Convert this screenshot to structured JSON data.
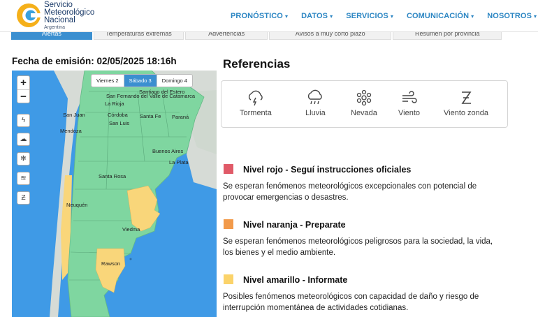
{
  "brand": {
    "line1": "Servicio",
    "line2": "Meteorológico",
    "line3": "Nacional",
    "line4": "Argentina"
  },
  "nav": [
    {
      "label": "PRONÓSTICO"
    },
    {
      "label": "DATOS"
    },
    {
      "label": "SERVICIOS"
    },
    {
      "label": "COMUNICACIÓN"
    },
    {
      "label": "NOSOTROS"
    }
  ],
  "tabs": [
    {
      "label": "Alertas"
    },
    {
      "label": "Temperaturas extremas"
    },
    {
      "label": "Advertencias"
    },
    {
      "label": "Avisos a muy corto plazo"
    },
    {
      "label": "Resumen por provincia"
    }
  ],
  "fecha": "Fecha de emisión: 02/05/2025 18:16h",
  "map": {
    "zoom_in": "+",
    "zoom_out": "−",
    "days": [
      "Viernes 2",
      "Sábado 3",
      "Domingo 4"
    ],
    "active_day": "Sábado 3",
    "places": [
      {
        "name": "Santiago del Estero"
      },
      {
        "name": "San Fernando del Valle de Catamarca"
      },
      {
        "name": "La Rioja"
      },
      {
        "name": "San Juan"
      },
      {
        "name": "Córdoba"
      },
      {
        "name": "Santa Fe"
      },
      {
        "name": "Paraná"
      },
      {
        "name": "Mendoza"
      },
      {
        "name": "San Luis"
      },
      {
        "name": "Buenos Aires"
      },
      {
        "name": "La Plata"
      },
      {
        "name": "Santa Rosa"
      },
      {
        "name": "Neuquén"
      },
      {
        "name": "Viedma"
      },
      {
        "name": "Rawson"
      }
    ],
    "colors": {
      "sea": "#3f9ae6",
      "green": "#7fd6a0",
      "yellow": "#f9d67a",
      "land": "#cfd8cf"
    }
  },
  "referencias": {
    "title": "Referencias",
    "items": [
      {
        "label": "Tormenta",
        "icon": "storm-icon"
      },
      {
        "label": "Lluvia",
        "icon": "rain-icon"
      },
      {
        "label": "Nevada",
        "icon": "snow-icon"
      },
      {
        "label": "Viento",
        "icon": "wind-icon"
      },
      {
        "label": "Viento zonda",
        "icon": "zonda-wind-icon"
      }
    ]
  },
  "levels": [
    {
      "title": "Nivel rojo - Seguí instrucciones oficiales",
      "desc": "Se esperan fenómenos meteorológicos excepcionales con potencial de provocar emergencias o desastres.",
      "color": "#e05a68"
    },
    {
      "title": "Nivel naranja - Preparate",
      "desc": "Se esperan fenómenos meteorológicos peligrosos para la sociedad, la vida, los bienes y el medio ambiente.",
      "color": "#f29a4a"
    },
    {
      "title": "Nivel amarillo - Informate",
      "desc": "Posibles fenómenos meteorológicos con capacidad de daño y riesgo de interrupción momentánea de actividades cotidianas.",
      "color": "#fbd36a"
    }
  ]
}
